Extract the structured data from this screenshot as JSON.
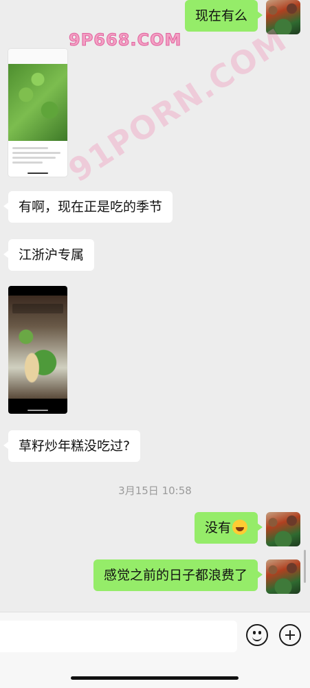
{
  "messages": {
    "m1": "现在有么",
    "m2": "有啊，现在正是吃的季节",
    "m3": "江浙沪专属",
    "m4": "草籽炒年糕没吃过?",
    "m5": "没有",
    "m6": "感觉之前的日子都浪费了"
  },
  "timestamp": "3月15日 10:58",
  "watermarks": {
    "top": "9P668.COM",
    "diagonal": "91PORN.COM"
  },
  "icons": {
    "emoji_button": "smiley-icon",
    "plus_button": "plus-circle-icon",
    "laugh_emoji": "laughing-tears-emoji"
  },
  "colors": {
    "background": "#ededed",
    "my_bubble": "#95ec69",
    "their_bubble": "#ffffff"
  }
}
